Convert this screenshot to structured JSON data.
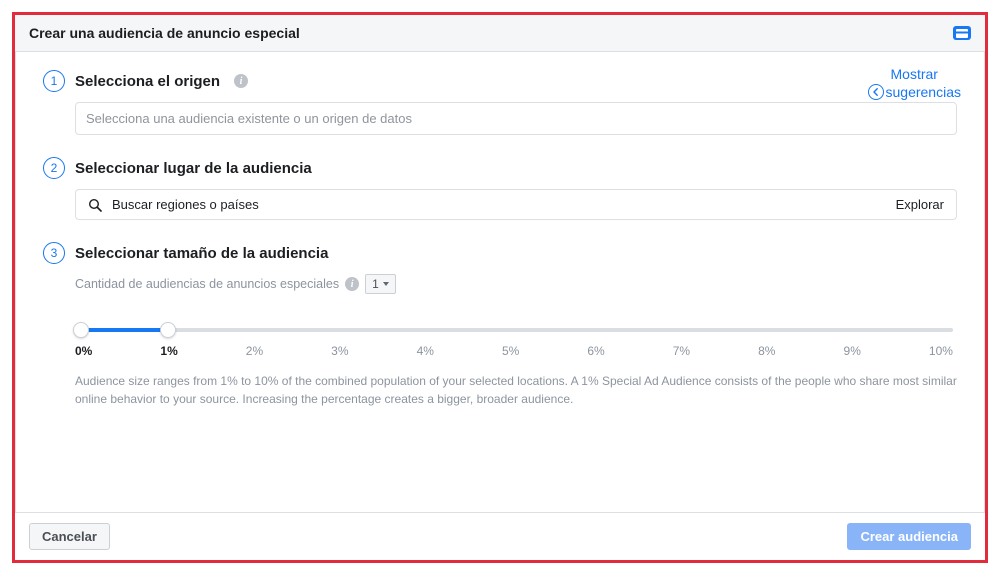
{
  "header": {
    "title": "Crear una audiencia de anuncio especial"
  },
  "suggestions": {
    "line1": "Mostrar",
    "line2": "sugerencias"
  },
  "step1": {
    "num": "1",
    "title": "Selecciona el origen",
    "placeholder": "Selecciona una audiencia existente o un origen de datos"
  },
  "step2": {
    "num": "2",
    "title": "Seleccionar lugar de la audiencia",
    "placeholder": "Buscar regiones o países",
    "explore": "Explorar"
  },
  "step3": {
    "num": "3",
    "title": "Seleccionar tamaño de la audiencia",
    "qty_label": "Cantidad de audiencias de anuncios especiales",
    "qty_value": "1",
    "slider": {
      "min_pos_pct": 0,
      "max_pos_pct": 10,
      "ticks": [
        "0%",
        "1%",
        "2%",
        "3%",
        "4%",
        "5%",
        "6%",
        "7%",
        "8%",
        "9%",
        "10%"
      ],
      "active_indices": [
        0,
        1
      ]
    },
    "help": "Audience size ranges from 1% to 10% of the combined population of your selected locations. A 1% Special Ad Audience consists of the people who share most similar online behavior to your source. Increasing the percentage creates a bigger, broader audience."
  },
  "footer": {
    "cancel": "Cancelar",
    "create": "Crear audiencia"
  }
}
